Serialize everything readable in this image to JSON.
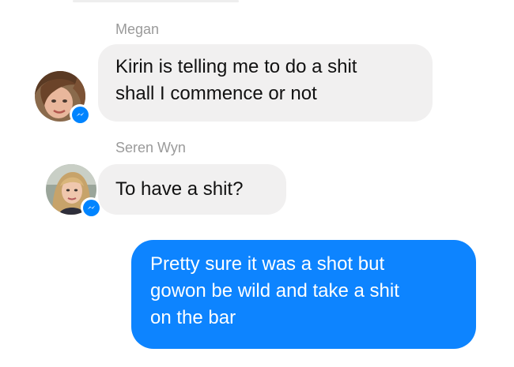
{
  "conversation": {
    "messages": [
      {
        "sender": "Megan",
        "lines": [
          "Kirin is telling me to do a shit",
          "shall I commence or not"
        ]
      },
      {
        "sender": "Seren Wyn",
        "lines": [
          "To have a shit?"
        ]
      },
      {
        "sender": "",
        "lines": [
          "Pretty sure it was a shot but",
          "gowon be wild and take a shit",
          "on the bar"
        ]
      }
    ]
  },
  "icons": {
    "badge": "messenger-bolt-icon",
    "avatar_megan": "avatar-photo",
    "avatar_seren": "avatar-photo"
  },
  "colors": {
    "outgoing_bubble": "#0d84ff",
    "incoming_bubble": "#f1f0f0",
    "sender_name": "#9a9a9a",
    "badge": "#0084ff"
  }
}
